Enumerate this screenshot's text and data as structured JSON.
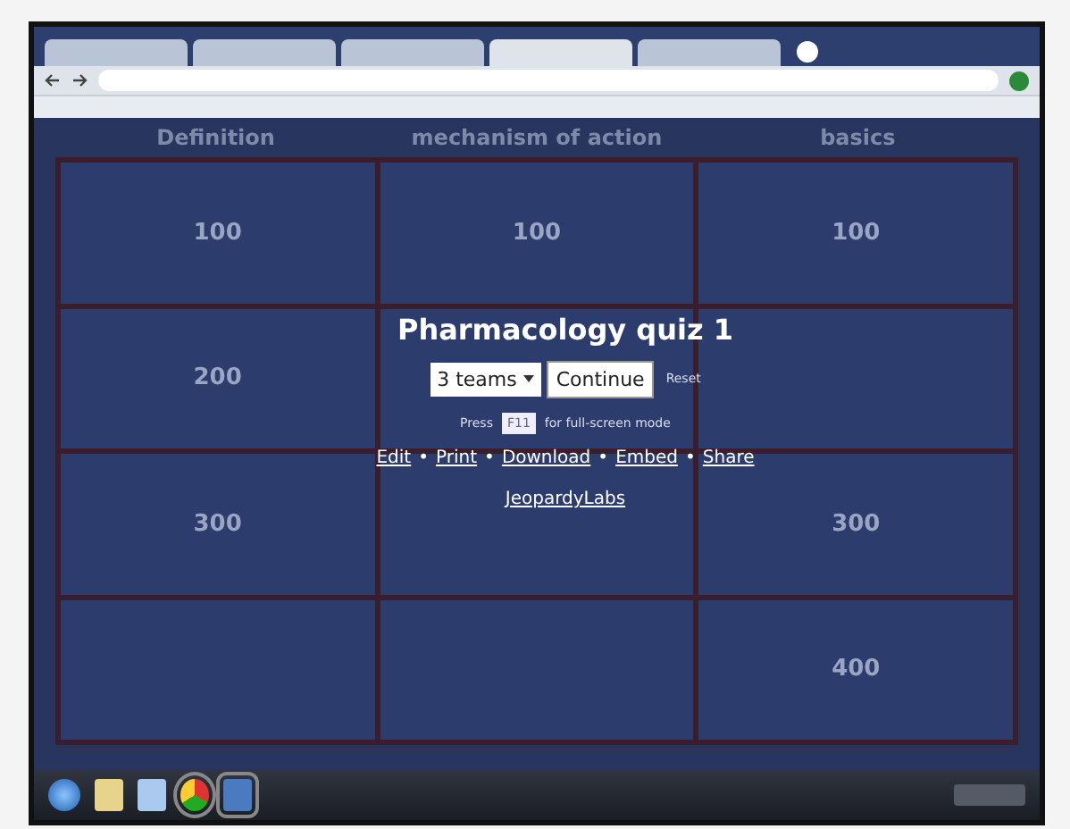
{
  "browser": {
    "tabs": [
      {
        "selected": false
      },
      {
        "selected": false
      },
      {
        "selected": false
      },
      {
        "selected": true
      },
      {
        "selected": false
      }
    ]
  },
  "board": {
    "categories": [
      "Definition",
      "mechanism of action",
      "basics"
    ],
    "rows": [
      {
        "cells": [
          {
            "value": "100"
          },
          {
            "value": "100"
          },
          {
            "value": "100"
          }
        ]
      },
      {
        "cells": [
          {
            "value": "200"
          },
          {},
          {}
        ]
      },
      {
        "cells": [
          {
            "value": "300"
          },
          {},
          {
            "value": "300"
          }
        ]
      },
      {
        "cells": [
          {},
          {},
          {
            "value": "400"
          }
        ]
      }
    ]
  },
  "overlay": {
    "title": "Pharmacology quiz 1",
    "teams_select": "3 teams",
    "continue_button": "Continue",
    "reset_link": "Reset",
    "hint_before": "Press",
    "hint_key": "F11",
    "hint_after": "for full-screen mode",
    "links": [
      "Edit",
      "Print",
      "Download",
      "Embed",
      "Share"
    ],
    "separator": "•",
    "brand_link": "JeopardyLabs"
  }
}
